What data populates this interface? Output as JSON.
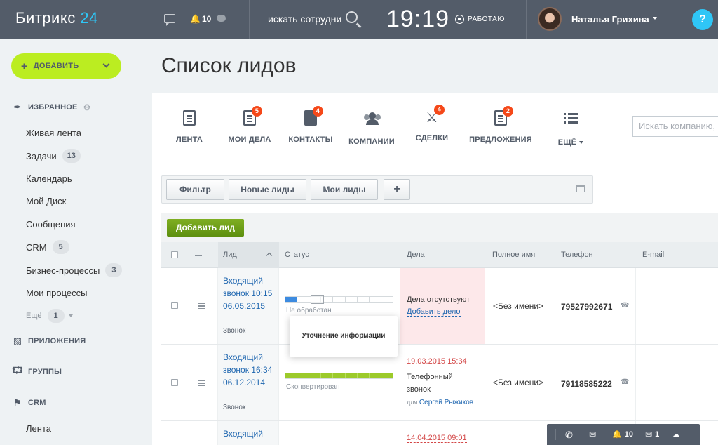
{
  "topbar": {
    "logo_text": "Битрикс",
    "logo_num": "24",
    "notifications_count": "10",
    "search_placeholder": "искать сотрудни",
    "clock": "19:19",
    "work_status": "РАБОТАЮ",
    "user_name": "Наталья Грихина",
    "help_label": "?"
  },
  "sidebar": {
    "add_label": "ДОБАВИТЬ",
    "favorites_label": "ИЗБРАННОЕ",
    "items": [
      {
        "label": "Живая лента",
        "badge": ""
      },
      {
        "label": "Задачи",
        "badge": "13"
      },
      {
        "label": "Календарь",
        "badge": ""
      },
      {
        "label": "Мой Диск",
        "badge": ""
      },
      {
        "label": "Сообщения",
        "badge": ""
      },
      {
        "label": "CRM",
        "badge": "5"
      },
      {
        "label": "Бизнес-процессы",
        "badge": "3"
      },
      {
        "label": "Мои процессы",
        "badge": ""
      }
    ],
    "more_label": "Ещё",
    "more_badge": "1",
    "apps_label": "ПРИЛОЖЕНИЯ",
    "groups_label": "ГРУППЫ",
    "crm_label": "CRM",
    "crm_item": "Лента"
  },
  "page": {
    "title": "Список лидов"
  },
  "toolbar": {
    "items": [
      {
        "label": "ЛЕНТА",
        "badge": ""
      },
      {
        "label": "МОИ ДЕЛА",
        "badge": "5"
      },
      {
        "label": "КОНТАКТЫ",
        "badge": "4"
      },
      {
        "label": "КОМПАНИИ",
        "badge": ""
      },
      {
        "label": "СДЕЛКИ",
        "badge": "4"
      },
      {
        "label": "ПРЕДЛОЖЕНИЯ",
        "badge": "2"
      },
      {
        "label": "ЕЩЁ",
        "badge": ""
      }
    ],
    "company_search_placeholder": "Искать компанию,"
  },
  "filters": {
    "buttons": [
      "Фильтр",
      "Новые лиды",
      "Мои лиды",
      "+"
    ]
  },
  "add_lead_label": "Добавить лид",
  "table": {
    "columns": [
      "Лид",
      "Статус",
      "Дела",
      "Полное имя",
      "Телефон",
      "E-mail"
    ],
    "rows": [
      {
        "lead": "Входящий звонок 10:15 06.05.2015",
        "source": "Звонок",
        "status_text": "Не обработан",
        "status_progress": 0.1,
        "deal_text": "Дела отсутствуют",
        "deal_link": "Добавить дело",
        "name": "<Без имени>",
        "phone": "79527992671"
      },
      {
        "lead": "Входящий звонок 16:34 06.12.2014",
        "source": "Звонок",
        "status_text": "Сконвертирован",
        "status_progress": 1,
        "deal_date": "19.03.2015 15:34",
        "deal_title": "Телефонный звонок",
        "deal_for": "для",
        "deal_person": "Сергей Рыжиков",
        "name": "<Без имени>",
        "phone": "79118585222"
      },
      {
        "lead": "Входящий",
        "deal_date": "14.04.2015 09:01"
      }
    ]
  },
  "popup": {
    "text": "Уточнение информации"
  },
  "statusbar": {
    "notifications": "10",
    "messages": "1"
  }
}
